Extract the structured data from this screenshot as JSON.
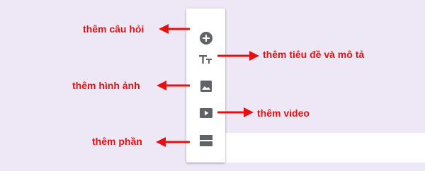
{
  "toolbar": {
    "items": [
      {
        "icon": "add-circle-icon",
        "annotation": "thêm câu hỏi"
      },
      {
        "icon": "title-text-icon",
        "glyph": "Tт",
        "annotation": "thêm tiêu đề và mô tả"
      },
      {
        "icon": "image-icon",
        "annotation": "thêm hình ảnh"
      },
      {
        "icon": "video-play-icon",
        "annotation": "thêm video"
      },
      {
        "icon": "section-icon",
        "annotation": "thêm phần"
      }
    ]
  },
  "form": {
    "required_marker": "*"
  },
  "colors": {
    "background": "#ede7f6",
    "icon": "#5f6368",
    "annotation": "#e51010",
    "panel": "#ffffff"
  }
}
